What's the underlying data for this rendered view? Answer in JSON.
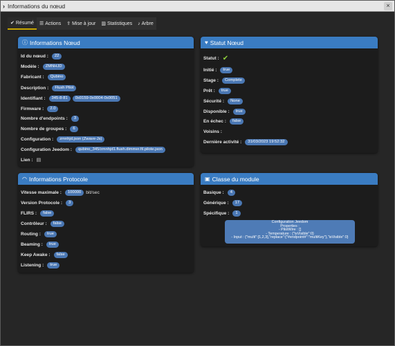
{
  "window": {
    "title": "Informations du nœud",
    "close": "×",
    "chevron": "›"
  },
  "tabs": [
    {
      "label": "Résumé",
      "icon": "check-icon"
    },
    {
      "label": "Actions",
      "icon": "list-icon"
    },
    {
      "label": "Mise à jour",
      "icon": "upload-icon"
    },
    {
      "label": "Statistiques",
      "icon": "chart-icon"
    },
    {
      "label": "Arbre",
      "icon": "bell-icon"
    }
  ],
  "node_info": {
    "title": "Informations Nœud",
    "node_id_label": "Id du nœud :",
    "node_id": "22",
    "model_label": "Modèle :",
    "model": "ZMNHJD",
    "maker_label": "Fabricant :",
    "maker": "Qubino",
    "description_label": "Description :",
    "description": "Flush Pilot",
    "identifier_label": "Identifiant :",
    "identifier_a": "345-8-81",
    "identifier_b": "0x0159-0x0004-0x0051",
    "firmware_label": "Firmware :",
    "firmware": "2.0",
    "endpoints_label": "Nombre d'endpoints :",
    "endpoints": "3",
    "groups_label": "Nombre de groupes :",
    "groups": "6",
    "configuration_label": "Configuration :",
    "configuration": "zmnhjd.json (Zwave-Js)",
    "jeedom_config_label": "Configuration Jeedom :",
    "jeedom_config": "qubino_345/zmnhjd1.flush.dimmer.fil.pilote.json",
    "link_label": "Lien :"
  },
  "node_status": {
    "title": "Statut Nœud",
    "status_label": "Statut :",
    "init_label": "Initié :",
    "init": "true",
    "stage_label": "Stage :",
    "stage": "Complete",
    "ready_label": "Prêt :",
    "ready": "true",
    "security_label": "Sécurité :",
    "security": "None",
    "available_label": "Disponible :",
    "available": "true",
    "failed_label": "En échec :",
    "failed": "false",
    "neighbors_label": "Voisins :",
    "last_activity_label": "Dernière activité :",
    "last_activity": "31/03/2023 19:52:32"
  },
  "protocol_info": {
    "title": "Informations Protocole",
    "max_speed_label": "Vitesse maximale :",
    "max_speed": "100000",
    "max_speed_unit": "bit/sec",
    "protocol_version_label": "Version Protocole :",
    "protocol_version": "3",
    "flirs_label": "FLIRS :",
    "flirs": "false",
    "controller_label": "Contrôleur :",
    "controller": "false",
    "routing_label": "Routing :",
    "routing": "true",
    "beaming_label": "Beaming :",
    "beaming": "true",
    "keep_awake_label": "Keep Awake :",
    "keep_awake": "false",
    "listening_label": "Listening :",
    "listening": "true"
  },
  "module_class": {
    "title": "Classe du module",
    "basic_label": "Basique :",
    "basic": "4",
    "generic_label": "Générique :",
    "generic": "17",
    "specific_label": "Spécifique :",
    "specific": "1",
    "config_line1": "Configuration Jeedom",
    "config_line2": "Properties :",
    "config_line3": "- PilotWire : []",
    "config_line4": "- Temperature : {\"isVisible\":0}",
    "config_line5": "- Input : {\"multi\":[1,2,3],\"replace\":{\"#endpoint#\":\"multiKey\"},\"isVisible\":0}"
  },
  "colors": {
    "panel_header": "#3a7cc2",
    "badge": "#4a77b3",
    "active_tab": "#c8a600",
    "check": "#8fd13a"
  }
}
